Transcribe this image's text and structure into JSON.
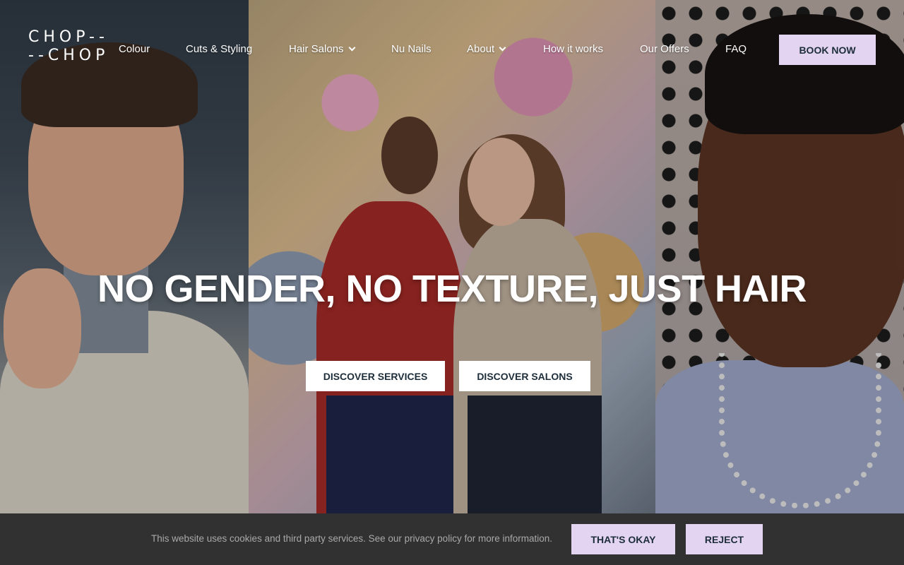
{
  "logo": {
    "line1": "CHOP--",
    "line2": "--CHOP"
  },
  "nav": {
    "items": [
      {
        "label": "Colour",
        "has_dropdown": false
      },
      {
        "label": "Cuts & Styling",
        "has_dropdown": false
      },
      {
        "label": "Hair Salons",
        "has_dropdown": true
      },
      {
        "label": "Nu Nails",
        "has_dropdown": false
      },
      {
        "label": "About",
        "has_dropdown": true
      },
      {
        "label": "How it works",
        "has_dropdown": false
      },
      {
        "label": "Our Offers",
        "has_dropdown": false
      },
      {
        "label": "FAQ",
        "has_dropdown": false
      }
    ],
    "book_label": "BOOK NOW"
  },
  "hero": {
    "headline": "NO GENDER, NO TEXTURE, JUST HAIR",
    "cta_services": "DISCOVER SERVICES",
    "cta_salons": "DISCOVER SALONS"
  },
  "cookie": {
    "text": "This website uses cookies and third party services. See our privacy policy for more information.",
    "ok_label": "THAT'S OKAY",
    "reject_label": "REJECT"
  },
  "colors": {
    "accent": "#e3d5f2",
    "button_text": "#1d2d3a",
    "cookie_bg": "#313131"
  }
}
